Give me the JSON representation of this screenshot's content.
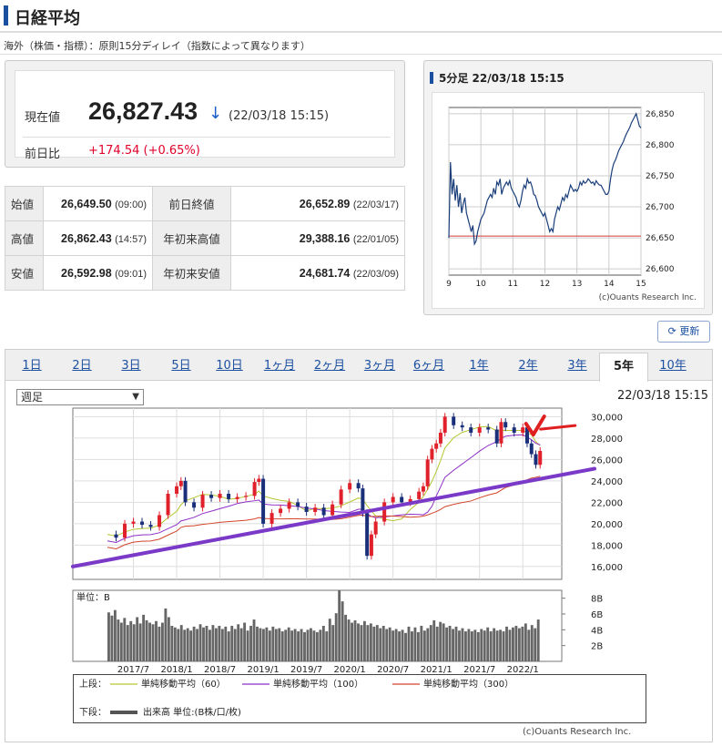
{
  "header": {
    "title": "日経平均"
  },
  "notice": "海外（株価・指標）：原則15分ディレイ（指数によって異なります）",
  "quote": {
    "current_label": "現在値",
    "current_value": "26,827.43",
    "direction_arrow": "↓",
    "current_time": "(22/03/18 15:15)",
    "change_label": "前日比",
    "change_value": "+174.54 (+0.65%)",
    "colors": {
      "up": "#e0002a",
      "down_arrow": "#1a5dc8"
    }
  },
  "stats": [
    {
      "label": "始値",
      "value": "26,649.50",
      "time": "(09:00)",
      "label2": "前日終値",
      "value2": "26,652.89",
      "time2": "(22/03/17)"
    },
    {
      "label": "高値",
      "value": "26,862.43",
      "time": "(14:57)",
      "label2": "年初来高値",
      "value2": "29,388.16",
      "time2": "(22/01/05)"
    },
    {
      "label": "安値",
      "value": "26,592.98",
      "time": "(09:01)",
      "label2": "年初来安値",
      "value2": "24,681.74",
      "time2": "(22/03/09)"
    }
  ],
  "refresh_label": "更新",
  "tabs": [
    "1日",
    "2日",
    "3日",
    "5日",
    "10日",
    "1ヶ月",
    "2ヶ月",
    "3ヶ月",
    "6ヶ月",
    "1年",
    "2年",
    "3年",
    "5年",
    "10年"
  ],
  "active_tab": 12,
  "period_select": "週足",
  "main_time": "22/03/18 15:15",
  "credit": "(c)Ouants Research Inc.",
  "chart_data": [
    {
      "type": "line",
      "title": "5分足 22/03/18 15:15",
      "x_ticks": [
        "9",
        "10",
        "11",
        "12",
        "13",
        "14",
        "15"
      ],
      "ylim": [
        26590,
        26860
      ],
      "y_ticks": [
        "26,850",
        "26,800",
        "26,750",
        "26,700",
        "26,650",
        "26,600"
      ],
      "reference_line": 26652.89,
      "series": [
        {
          "x": [
            9.0,
            9.05,
            9.1,
            9.15,
            9.2,
            9.25,
            9.3,
            9.35,
            9.4,
            9.45,
            9.5,
            9.55,
            9.6,
            9.65,
            9.7,
            9.75,
            9.8,
            9.85,
            9.9,
            9.95,
            10.0,
            10.05,
            10.1,
            10.15,
            10.2,
            10.25,
            10.3,
            10.35,
            10.4,
            10.45,
            10.5,
            10.55,
            10.6,
            10.65,
            10.7,
            10.75,
            10.8,
            10.85,
            10.9,
            10.95,
            11.0,
            11.05,
            11.1,
            11.15,
            11.2,
            11.25,
            11.3,
            11.35,
            11.4,
            11.45,
            11.5,
            11.55,
            11.6,
            11.65,
            11.7,
            11.75,
            11.8,
            11.85,
            11.9,
            11.95,
            12.0,
            12.05,
            12.1,
            12.15,
            12.2,
            12.25,
            12.3,
            12.35,
            12.4,
            12.45,
            12.5,
            12.55,
            12.6,
            12.65,
            12.7,
            12.75,
            12.8,
            12.85,
            12.9,
            12.95,
            13.0,
            13.05,
            13.1,
            13.15,
            13.2,
            13.25,
            13.3,
            13.35,
            13.4,
            13.45,
            13.5,
            13.55,
            13.6,
            13.65,
            13.7,
            13.75,
            13.8,
            13.85,
            13.9,
            13.95,
            14.0,
            14.05,
            14.1,
            14.15,
            14.2,
            14.25,
            14.3,
            14.35,
            14.4,
            14.45,
            14.5,
            14.55,
            14.6,
            14.65,
            14.7,
            14.75,
            14.8,
            14.85,
            14.9,
            14.95,
            15.0
          ],
          "values": [
            26650,
            26772,
            26720,
            26745,
            26710,
            26735,
            26700,
            26722,
            26690,
            26705,
            26715,
            26690,
            26680,
            26670,
            26660,
            26670,
            26640,
            26645,
            26660,
            26670,
            26680,
            26685,
            26690,
            26700,
            26710,
            26715,
            26720,
            26715,
            26730,
            26720,
            26740,
            26735,
            26745,
            26720,
            26730,
            26735,
            26740,
            26735,
            26742,
            26730,
            26725,
            26720,
            26715,
            26705,
            26700,
            26710,
            26725,
            26735,
            26730,
            26745,
            26738,
            26740,
            26732,
            26720,
            26718,
            26710,
            26700,
            26695,
            26690,
            26685,
            26690,
            26680,
            26670,
            26660,
            26665,
            26660,
            26680,
            26690,
            26700,
            26695,
            26705,
            26715,
            26710,
            26720,
            26715,
            26725,
            26735,
            26730,
            26725,
            26728,
            26725,
            26730,
            26740,
            26735,
            26742,
            26738,
            26740,
            26745,
            26742,
            26738,
            26740,
            26735,
            26742,
            26738,
            26735,
            26735,
            26730,
            26725,
            26720,
            26720,
            26725,
            26745,
            26760,
            26770,
            26775,
            26782,
            26790,
            26795,
            26800,
            26805,
            26812,
            26818,
            26823,
            26828,
            26835,
            26840,
            26845,
            26850,
            26840,
            26830,
            26827
          ]
        }
      ]
    },
    {
      "type": "line",
      "title": "",
      "x_ticks": [
        "2017/7",
        "2018/1",
        "2018/7",
        "2019/1",
        "2019/7",
        "2020/1",
        "2020/7",
        "2021/1",
        "2021/7",
        "2022/1"
      ],
      "ylim": [
        14800,
        30800
      ],
      "y_ticks": [
        "30,000",
        "28,000",
        "26,000",
        "24,000",
        "22,000",
        "20,000",
        "18,000",
        "16,000"
      ],
      "series": [
        {
          "name": "単純移動平均（60）",
          "color": "#b5c631"
        },
        {
          "name": "単純移動平均（100）",
          "color": "#8e2fc8"
        },
        {
          "name": "単純移動平均（300）",
          "color": "#d2452a"
        },
        {
          "name": "close",
          "x": [
            2017.2,
            2017.3,
            2017.4,
            2017.5,
            2017.6,
            2017.7,
            2017.8,
            2017.9,
            2018.0,
            2018.05,
            2018.1,
            2018.2,
            2018.3,
            2018.4,
            2018.5,
            2018.6,
            2018.7,
            2018.8,
            2018.9,
            2018.95,
            2019.0,
            2019.1,
            2019.2,
            2019.3,
            2019.4,
            2019.5,
            2019.6,
            2019.7,
            2019.8,
            2019.9,
            2020.0,
            2020.1,
            2020.15,
            2020.2,
            2020.25,
            2020.3,
            2020.4,
            2020.5,
            2020.6,
            2020.7,
            2020.8,
            2020.85,
            2020.9,
            2020.95,
            2021.0,
            2021.05,
            2021.1,
            2021.2,
            2021.3,
            2021.4,
            2021.5,
            2021.6,
            2021.7,
            2021.75,
            2021.8,
            2021.9,
            2022.0,
            2022.05,
            2022.1,
            2022.15,
            2022.2
          ],
          "values": [
            19000,
            18700,
            20000,
            20200,
            19900,
            19700,
            20800,
            22800,
            23500,
            24000,
            22000,
            21500,
            22700,
            22400,
            22800,
            22300,
            22500,
            22600,
            23900,
            24200,
            20000,
            21000,
            21400,
            22000,
            21600,
            21100,
            21500,
            20800,
            21800,
            23200,
            23800,
            23300,
            21000,
            17000,
            19000,
            20200,
            22000,
            22500,
            22000,
            22300,
            23000,
            23500,
            26000,
            27000,
            27500,
            28500,
            30000,
            29200,
            29000,
            28500,
            29000,
            28800,
            27500,
            29500,
            29000,
            28500,
            29000,
            27500,
            26500,
            25500,
            26800
          ]
        },
        {
          "name": "trendline",
          "color": "#7b39c8",
          "x": [
            2016.8,
            2022.45
          ],
          "values": [
            16000,
            24800
          ]
        }
      ]
    },
    {
      "type": "bar",
      "unit_label": "単位：B",
      "ylim": [
        0,
        9
      ],
      "y_ticks": [
        "8B",
        "6B",
        "4B",
        "2B"
      ],
      "legend_label": "出来高 単位:(B株/口/枚)",
      "values": [
        6.2,
        5.8,
        6.5,
        5.3,
        4.9,
        5.5,
        4.6,
        5.1,
        4.7,
        5.6,
        4.8,
        5.9,
        5.2,
        4.9,
        4.7,
        5.1,
        4.4,
        4.9,
        6.7,
        5.6,
        4.5,
        4.3,
        4.1,
        4.6,
        4.0,
        4.2,
        3.9,
        4.4,
        4.1,
        4.7,
        4.3,
        4.5,
        4.0,
        4.6,
        4.2,
        4.5,
        4.1,
        4.4,
        3.8,
        4.5,
        4.1,
        4.7,
        4.2,
        4.9,
        3.9,
        4.5,
        5.3,
        4.4,
        4.2,
        4.1,
        4.3,
        3.9,
        4.4,
        4.1,
        4.2,
        3.8,
        4.0,
        4.3,
        3.9,
        4.1,
        3.8,
        4.1,
        3.7,
        4.0,
        4.2,
        3.9,
        3.7,
        4.0,
        4.5,
        3.8,
        5.4,
        4.6,
        6.1,
        9.0,
        7.6,
        5.9,
        5.3,
        4.9,
        5.2,
        4.8,
        4.6,
        5.1,
        4.6,
        4.8,
        4.4,
        4.6,
        4.2,
        4.5,
        4.1,
        4.3,
        3.9,
        4.1,
        3.8,
        4.0,
        3.6,
        4.4,
        3.8,
        4.3,
        3.7,
        4.5,
        3.9,
        4.2,
        4.6,
        5.2,
        4.4,
        5.0,
        4.8,
        4.3,
        4.5,
        4.1,
        4.4,
        3.9,
        4.2,
        3.8,
        4.1,
        3.8,
        4.0,
        3.7,
        4.1,
        3.9,
        4.3,
        3.8,
        4.2,
        3.9,
        4.0,
        3.8,
        4.4,
        4.0,
        4.3,
        4.5,
        4.2,
        4.4,
        4.8,
        4.0,
        4.6,
        4.2,
        5.3
      ]
    }
  ]
}
